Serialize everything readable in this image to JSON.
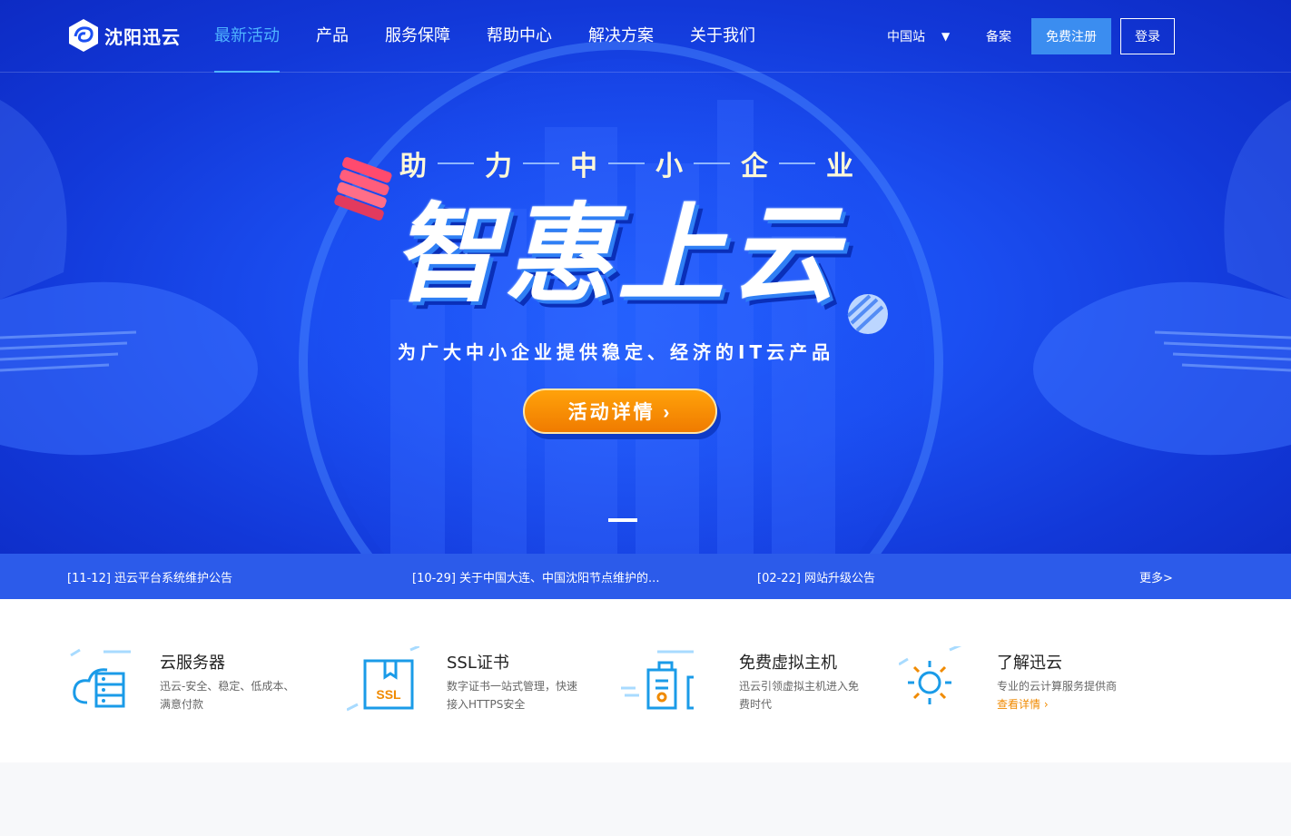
{
  "brand": {
    "name": "沈阳迅云"
  },
  "nav": {
    "items": [
      {
        "label": "最新活动",
        "active": true
      },
      {
        "label": "产品"
      },
      {
        "label": "服务保障"
      },
      {
        "label": "帮助中心"
      },
      {
        "label": "解决方案"
      },
      {
        "label": "关于我们"
      }
    ]
  },
  "header": {
    "region": "中国站",
    "region_caret": "▼",
    "beian": "备案",
    "register": "免费注册",
    "login": "登录"
  },
  "hero": {
    "subtitle_chars": [
      "助",
      "力",
      "中",
      "小",
      "企",
      "业"
    ],
    "title": "智惠上云",
    "desc": "为广大中小企业提供稳定、经济的IT云产品",
    "cta": "活动详情 ›"
  },
  "notices": {
    "items": [
      "[11-12] 迅云平台系统维护公告",
      "[10-29] 关于中国大连、中国沈阳节点维护的...",
      "[02-22] 网站升级公告"
    ],
    "more": "更多>"
  },
  "features": [
    {
      "title": "云服务器",
      "desc": "迅云-安全、稳定、低成本、满意付款",
      "icon": "cloud-server-icon"
    },
    {
      "title": "SSL证书",
      "desc": "数字证书一站式管理，快速接入HTTPS安全",
      "icon": "ssl-certificate-icon",
      "icon_text": "SSL"
    },
    {
      "title": "免费虚拟主机",
      "desc": "迅云引领虚拟主机进入免费时代",
      "icon": "virtual-host-icon"
    },
    {
      "title": "了解迅云",
      "desc": "专业的云计算服务提供商",
      "link": "查看详情 ›",
      "icon": "sun-icon"
    }
  ],
  "colors": {
    "hero_bg": "#1b4ff2",
    "nav_active": "#4fb3ff",
    "register_btn": "#3b8df0",
    "cta_orange": "#f88d00",
    "notice_bar": "#2c5bea",
    "feature_icon": "#1a9be8",
    "link_orange": "#f08a00"
  }
}
